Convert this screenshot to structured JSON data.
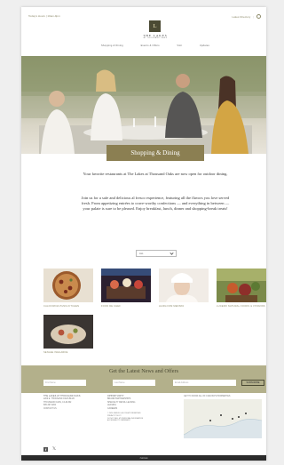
{
  "header": {
    "hours_link": "Today's Hours | 10am-9pm",
    "directory_link": "Lakes Directory",
    "logo_initial": "L",
    "logo_title": "THE LAKES",
    "logo_subtitle": "AT THOUSAND OAKS",
    "nav": [
      "Shopping & Dining",
      "Events & Offers",
      "Visit",
      "Updates"
    ]
  },
  "hero": {
    "banner": "Shopping & Dining"
  },
  "intro": {
    "line1": "Your favorite restaurants at The Lakes at Thousand Oaks are now open for outdoor dining.",
    "line2": "Join us for a safe and delicious al fresco experience, featuring all the flavors you love served fresh. From appetizing entrées to crave-worthy confections — and everything in between — your palate is sure to be pleased. Enjoy breakfast, lunch, dinner and shopping-break treats!"
  },
  "filter": {
    "selected": "ALL"
  },
  "tenants": [
    {
      "name": "CALIFORNIA PIZZA KITCHEN",
      "icon": "pizza"
    },
    {
      "name": "FOOD DE CHEF",
      "icon": "dessert"
    },
    {
      "name": "HAIRLOOM MEDSPA",
      "icon": "spa"
    },
    {
      "name": "LUCERO NATURAL FOODS & VITAMINS",
      "icon": "produce"
    },
    {
      "name": "SENLEE INEGARDE",
      "icon": "platter"
    }
  ],
  "newsletter": {
    "title": "Get the Latest News and Offers",
    "first_name_placeholder": "First Name",
    "last_name_placeholder": "Last Name",
    "email_placeholder": "Email Address",
    "subscribe_label": "SUBSCRIBE"
  },
  "footer": {
    "col1": [
      "THE LAKES AT THOUSAND OAKS",
      "2200 E. THOUSAND OAKS BLVD",
      "THOUSAND OAKS, CA 91362",
      "805.497.9200",
      "CONTACT US"
    ],
    "col2": [
      "OPPORTUNITY",
      "BRAND PARTNERSHIPS",
      "SPECIALTY RETAIL LEASING",
      "LEASING",
      "CAREERS"
    ],
    "col2_small": [
      "© 2020 CARUSO. ALL RIGHTS RESERVED.",
      "PRIVACY POLICY",
      "DO NOT SELL MY PERSONAL INFORMATION",
      "ACCESSIBILITY STATEMENT"
    ],
    "map_title": "GET TO KNOW ALL OF CARUSO'S PROPERTIES",
    "brand": "Caruso"
  },
  "colors": {
    "accent": "#8d8a6a",
    "banner": "#8b7f52",
    "newsletter_bg": "#b3b08b",
    "logo_bg": "#4b4a34"
  }
}
